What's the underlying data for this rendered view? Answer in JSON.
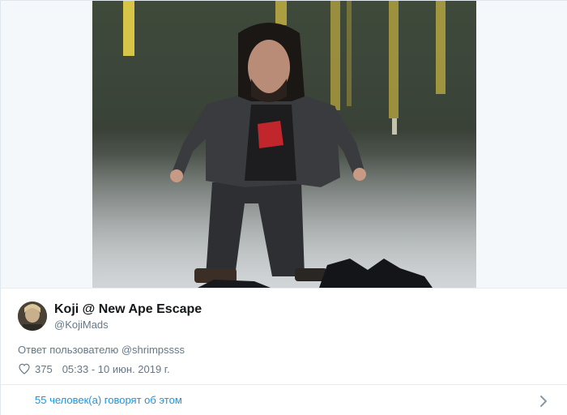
{
  "tweet": {
    "author": {
      "display_name": "Koji @ New Ape Escape",
      "handle": "@KojiMads",
      "avatar_icon": "avatar-photo"
    },
    "reply_to": "Ответ пользователю @shrimpssss",
    "likes": "375",
    "timestamp": "05:33 - 10 июн. 2019 г.",
    "footer_label": "55 человек(а) говорят об этом",
    "icons": {
      "like": "heart-outline-icon",
      "footer": "chevron-right-icon"
    },
    "colors": {
      "link": "#1b95e0",
      "secondary_text": "#657786",
      "primary_text": "#14171a"
    }
  }
}
